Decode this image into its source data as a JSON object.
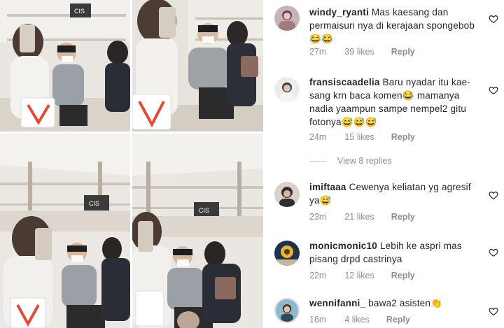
{
  "collage": {
    "store_signs": [
      "CIS",
      "CIS",
      "CIS",
      "CIS"
    ]
  },
  "comments": [
    {
      "username": "windy_ryanti",
      "text": "Mas kaesang dan permaisuri nya di kerajaan spongebob 😂😂",
      "time": "27m",
      "likes": "39 likes",
      "reply": "Reply"
    },
    {
      "username": "fransiscaadelia",
      "text": "Baru nyadar itu kae-sang krn baca komen😂 mamanya nadia yaampun sampe nempel2 gitu fotonya😅😅😅",
      "time": "24m",
      "likes": "15 likes",
      "reply": "Reply"
    },
    {
      "username": "imiftaaa",
      "text": "Cewenya keliatan yg agresif ya😅",
      "time": "23m",
      "likes": "21 likes",
      "reply": "Reply"
    },
    {
      "username": "monicmonic10",
      "text": "Lebih ke aspri mas pisang drpd castrinya",
      "time": "22m",
      "likes": "12 likes",
      "reply": "Reply"
    },
    {
      "username": "wennifanni_",
      "text": "bawa2 asisten👏",
      "time": "16m",
      "likes": "4 likes",
      "reply": "Reply"
    }
  ],
  "view_replies": "View 8 replies",
  "icons": {
    "like": "heart-outline-icon"
  },
  "colors": {
    "text": "#262626",
    "muted": "#8e8e8e"
  }
}
